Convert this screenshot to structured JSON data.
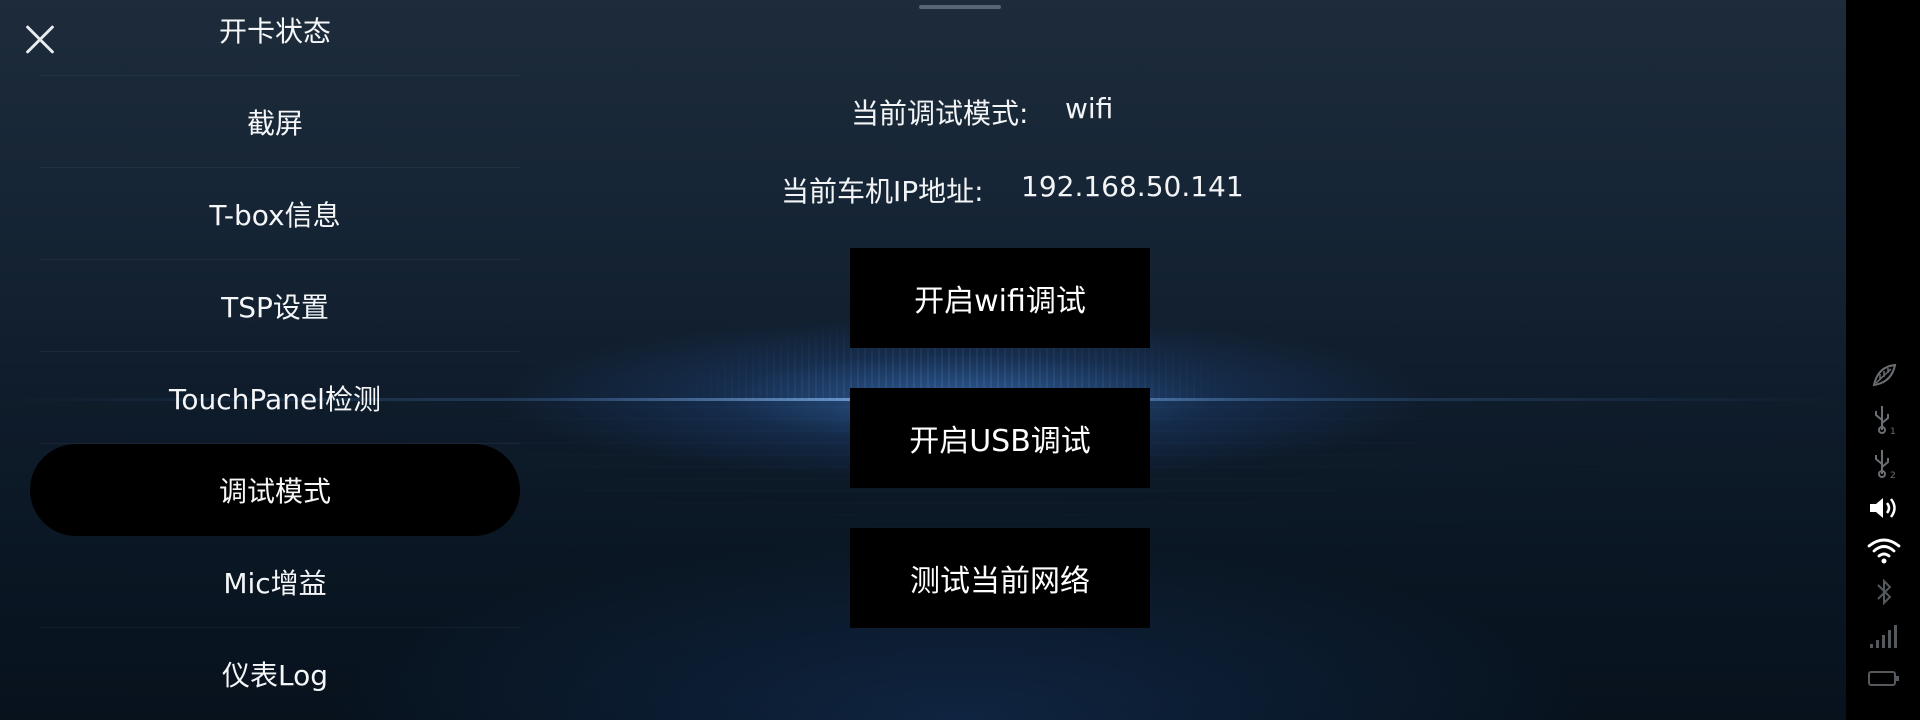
{
  "menu": {
    "items": [
      {
        "label": "开卡状态"
      },
      {
        "label": "截屏"
      },
      {
        "label": "T-box信息"
      },
      {
        "label": "TSP设置"
      },
      {
        "label": "TouchPanel检测"
      },
      {
        "label": "调试模式"
      },
      {
        "label": "Mic增益"
      },
      {
        "label": "仪表Log"
      }
    ],
    "selected": "调试模式"
  },
  "debug": {
    "mode_label": "当前调试模式:",
    "mode_value": "wifi",
    "ip_label": "当前车机IP地址:",
    "ip_value": "192.168.50.141"
  },
  "actions": {
    "wifi_debug": "开启wifi调试",
    "usb_debug": "开启USB调试",
    "test_network": "测试当前网络"
  },
  "status_bar": {
    "icons": [
      "leaf-icon",
      "usb-1-icon",
      "usb-2-icon",
      "volume-icon",
      "wifi-icon",
      "bluetooth-icon",
      "signal-icon",
      "battery-icon"
    ]
  }
}
